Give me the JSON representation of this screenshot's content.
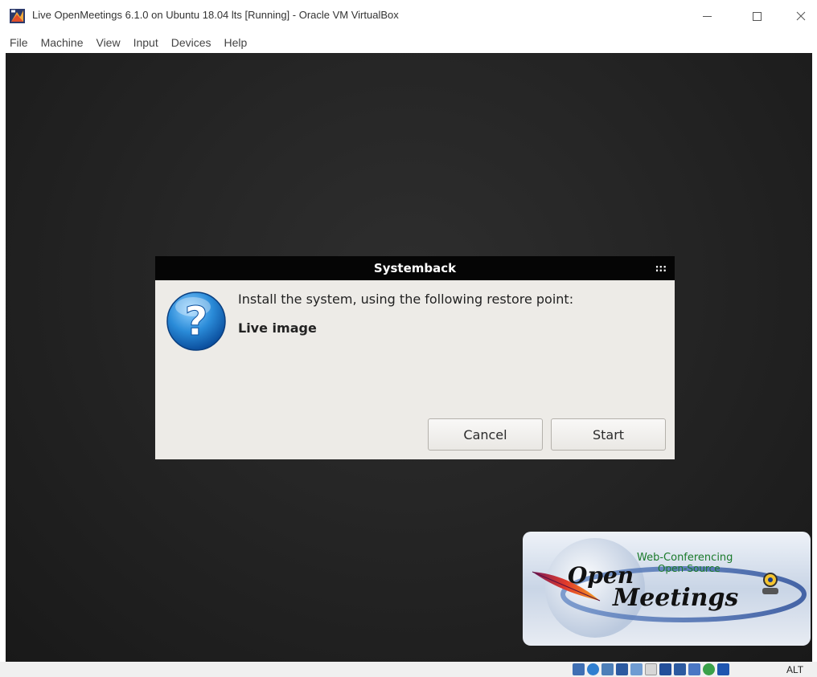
{
  "window": {
    "title": "Live OpenMeetings 6.1.0 on Ubuntu 18.04 lts [Running] - Oracle VM VirtualBox",
    "controls": {
      "minimize_icon": "minimize-icon",
      "maximize_icon": "maximize-icon",
      "close_label": "✕"
    }
  },
  "menu": [
    "File",
    "Machine",
    "View",
    "Input",
    "Devices",
    "Help"
  ],
  "dialog": {
    "title": "Systemback",
    "menu_dots": ":::",
    "message": "Install the system, using the following restore point:",
    "restore_point": "Live image",
    "cancel_label": "Cancel",
    "start_label": "Start",
    "icon": "question-icon"
  },
  "logo": {
    "line1": "Web-Conferencing",
    "line2": "Open-Source",
    "word_open": "Open",
    "word_meetings": "Meetings"
  },
  "statusbar": {
    "icons": [
      "hard-disk-icon",
      "optical-drive-icon",
      "audio-icon",
      "network-icon",
      "usb-icon",
      "shared-folders-icon",
      "display-icon",
      "video-capture-icon",
      "recording-icon",
      "mouse-integration-icon",
      "keyboard-arrow-icon"
    ],
    "host_key": "ALT"
  },
  "colors": {
    "dialog_title_bg": "#050505",
    "dialog_bg": "#edebe7",
    "vm_bg": "#262626",
    "statusbar_bg": "#f0f0f0"
  }
}
